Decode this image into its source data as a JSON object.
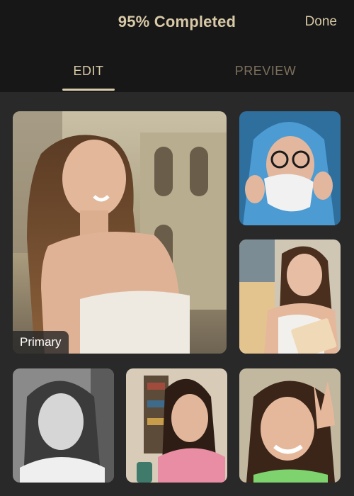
{
  "header": {
    "title": "95% Completed",
    "done_label": "Done"
  },
  "tabs": [
    {
      "label": "EDIT",
      "active": true
    },
    {
      "label": "PREVIEW",
      "active": false
    }
  ],
  "photos": {
    "main_badge": "Primary"
  },
  "colors": {
    "accent": "#d8c9a7",
    "inactive_tab": "#7b6f5c",
    "header_bg": "#171717",
    "content_bg": "#292929"
  }
}
